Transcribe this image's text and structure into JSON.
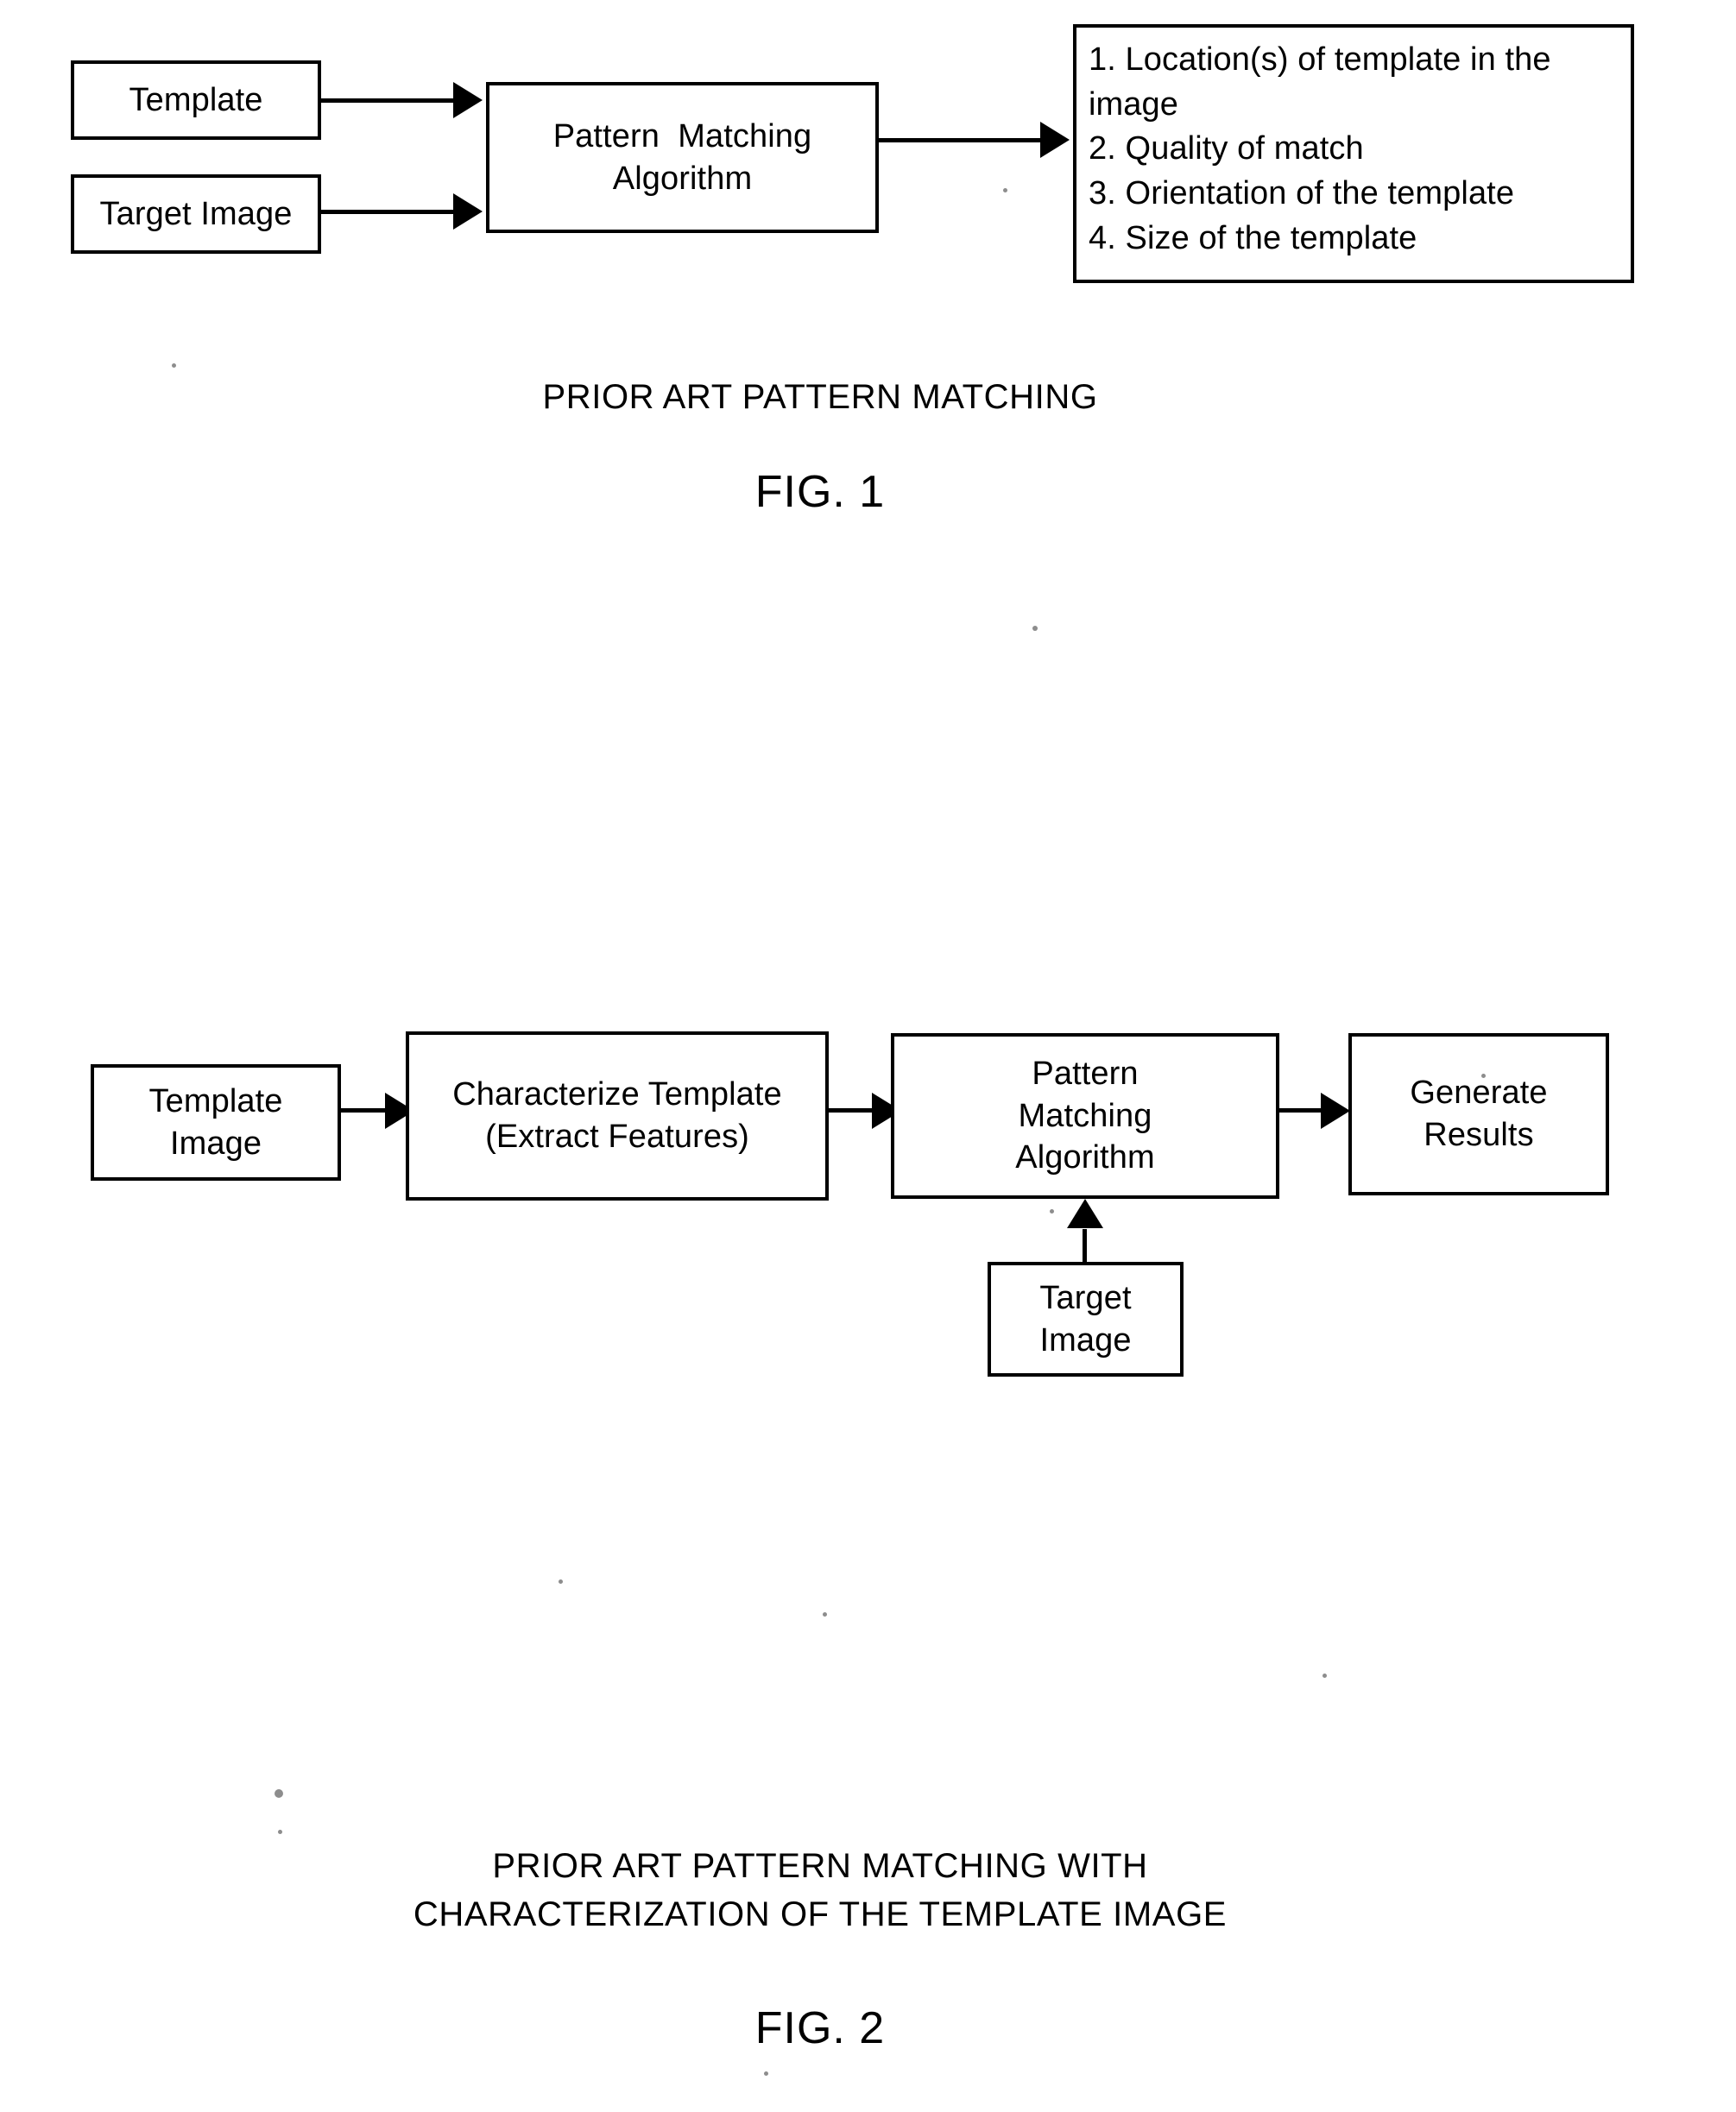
{
  "figure1": {
    "boxes": {
      "template": {
        "label": "Template"
      },
      "target_image": {
        "label": "Target Image"
      },
      "algorithm": {
        "line1": "Pattern  Matching",
        "line2": "Algorithm"
      },
      "results": {
        "items": [
          "1. Location(s) of template in the image",
          "2. Quality of match",
          "3. Orientation of the template",
          "4. Size of the template"
        ]
      }
    },
    "caption": "PRIOR ART PATTERN MATCHING",
    "fig_label": "FIG. 1"
  },
  "figure2": {
    "boxes": {
      "template_image": {
        "line1": "Template",
        "line2": "Image"
      },
      "characterize": {
        "line1": "Characterize Template",
        "line2": "(Extract Features)"
      },
      "algorithm": {
        "line1": "Pattern",
        "line2": "Matching",
        "line3": "Algorithm"
      },
      "generate_results": {
        "line1": "Generate",
        "line2": "Results"
      },
      "target_image": {
        "line1": "Target",
        "line2": "Image"
      }
    },
    "caption_line1": "PRIOR ART PATTERN MATCHING WITH",
    "caption_line2": "CHARACTERIZATION OF THE TEMPLATE IMAGE",
    "fig_label": "FIG. 2"
  },
  "colors": {
    "ink": "#000000",
    "paper": "#ffffff"
  }
}
